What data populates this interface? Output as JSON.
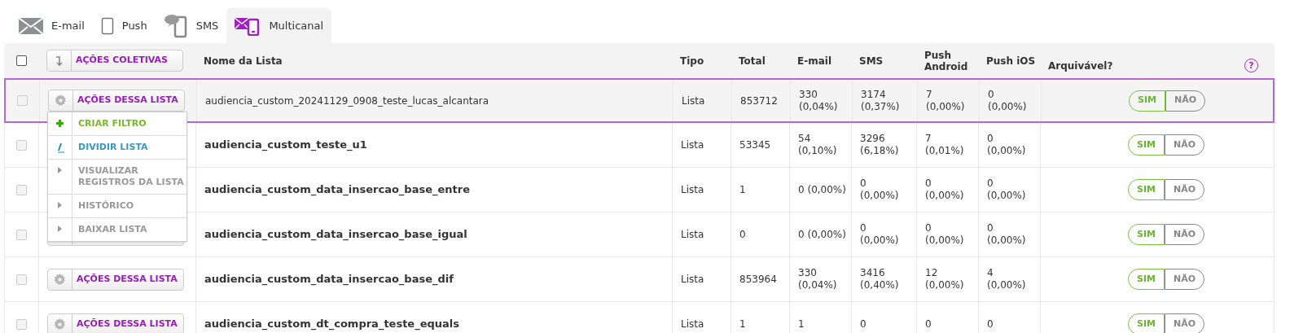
{
  "tabs": [
    {
      "label": "E-mail",
      "kind": "email",
      "selected": false
    },
    {
      "label": "Push",
      "kind": "push",
      "selected": false
    },
    {
      "label": "SMS",
      "kind": "sms",
      "selected": false
    },
    {
      "label": "Multicanal",
      "kind": "multi",
      "selected": true
    }
  ],
  "table": {
    "help": "?",
    "select_all": {
      "checked": false
    },
    "bulk_action": "AÇÕES COLETIVAS",
    "columns": [
      "Nome da Lista",
      "Tipo",
      "Total",
      "E-mail",
      "SMS",
      "Push Android",
      "Push iOS",
      "Arquivável?"
    ],
    "rows": [
      {
        "checked": false,
        "selected": true,
        "action": "AÇÕES DESSA LISTA",
        "name": "audiencia_custom_20241129_0908_teste_lucas_alcantara",
        "type": "Lista",
        "total": "853712",
        "email": [
          "330",
          "(0,04%)"
        ],
        "sms": [
          "3174",
          "(0,37%)"
        ],
        "android": [
          "7",
          "(0,00%)"
        ],
        "ios": [
          "0",
          "(0,00%)"
        ],
        "yes": "SIM",
        "no": "NÃO",
        "archivable": true
      },
      {
        "checked": false,
        "selected": false,
        "name": "audiencia_custom_teste_u1",
        "type": "Lista",
        "total": "53345",
        "email": [
          "54",
          "(0,10%)"
        ],
        "sms": [
          "3296",
          "(6,18%)"
        ],
        "android": [
          "7",
          "(0,01%)"
        ],
        "ios": [
          "0",
          "(0,00%)"
        ],
        "yes": "SIM",
        "no": "NÃO",
        "archivable": true
      },
      {
        "checked": false,
        "selected": false,
        "name": "audiencia_custom_data_insercao_base_entre",
        "type": "Lista",
        "total": "1",
        "email": [
          "0 (0,00%)"
        ],
        "sms": [
          "0",
          "(0,00%)"
        ],
        "android": [
          "0",
          "(0,00%)"
        ],
        "ios": [
          "0",
          "(0,00%)"
        ],
        "yes": "SIM",
        "no": "NÃO",
        "archivable": true
      },
      {
        "checked": false,
        "selected": false,
        "action_button": true,
        "name": "audiencia_custom_data_insercao_base_igual",
        "type": "Lista",
        "total": "0",
        "email": [
          "0 (0,00%)"
        ],
        "sms": [
          "0",
          "(0,00%)"
        ],
        "android": [
          "0",
          "(0,00%)"
        ],
        "ios": [
          "0",
          "(0,00%)"
        ],
        "yes": "SIM",
        "no": "NÃO",
        "archivable": true
      },
      {
        "checked": false,
        "selected": false,
        "action": "AÇÕES DESSA LISTA",
        "name": "audiencia_custom_data_insercao_base_dif",
        "type": "Lista",
        "total": "853964",
        "email": [
          "330",
          "(0,04%)"
        ],
        "sms": [
          "3416",
          "(0,40%)"
        ],
        "android": [
          "12",
          "(0,00%)"
        ],
        "ios": [
          "4",
          "(0,00%)"
        ],
        "yes": "SIM",
        "no": "NÃO",
        "archivable": true
      },
      {
        "checked": false,
        "selected": false,
        "action": "AÇÕES DESSA LISTA",
        "name": "audiencia_custom_dt_compra_teste_equals",
        "type": "Lista",
        "total": "1",
        "email": [
          "1"
        ],
        "sms": [
          "0"
        ],
        "android": [
          "0"
        ],
        "ios": [
          "0"
        ],
        "yes": "SIM",
        "no": "NÃO",
        "archivable": true
      }
    ]
  },
  "menu": {
    "items": [
      {
        "label": "CRIAR FILTRO",
        "kind": "add"
      },
      {
        "label": "DIVIDIR LISTA",
        "kind": "split"
      },
      {
        "label": "VISUALIZAR REGISTROS DA LISTA",
        "kind": "link"
      },
      {
        "label": "HISTÓRICO",
        "kind": "link"
      },
      {
        "label": "BAIXAR LISTA",
        "kind": "link"
      }
    ]
  }
}
